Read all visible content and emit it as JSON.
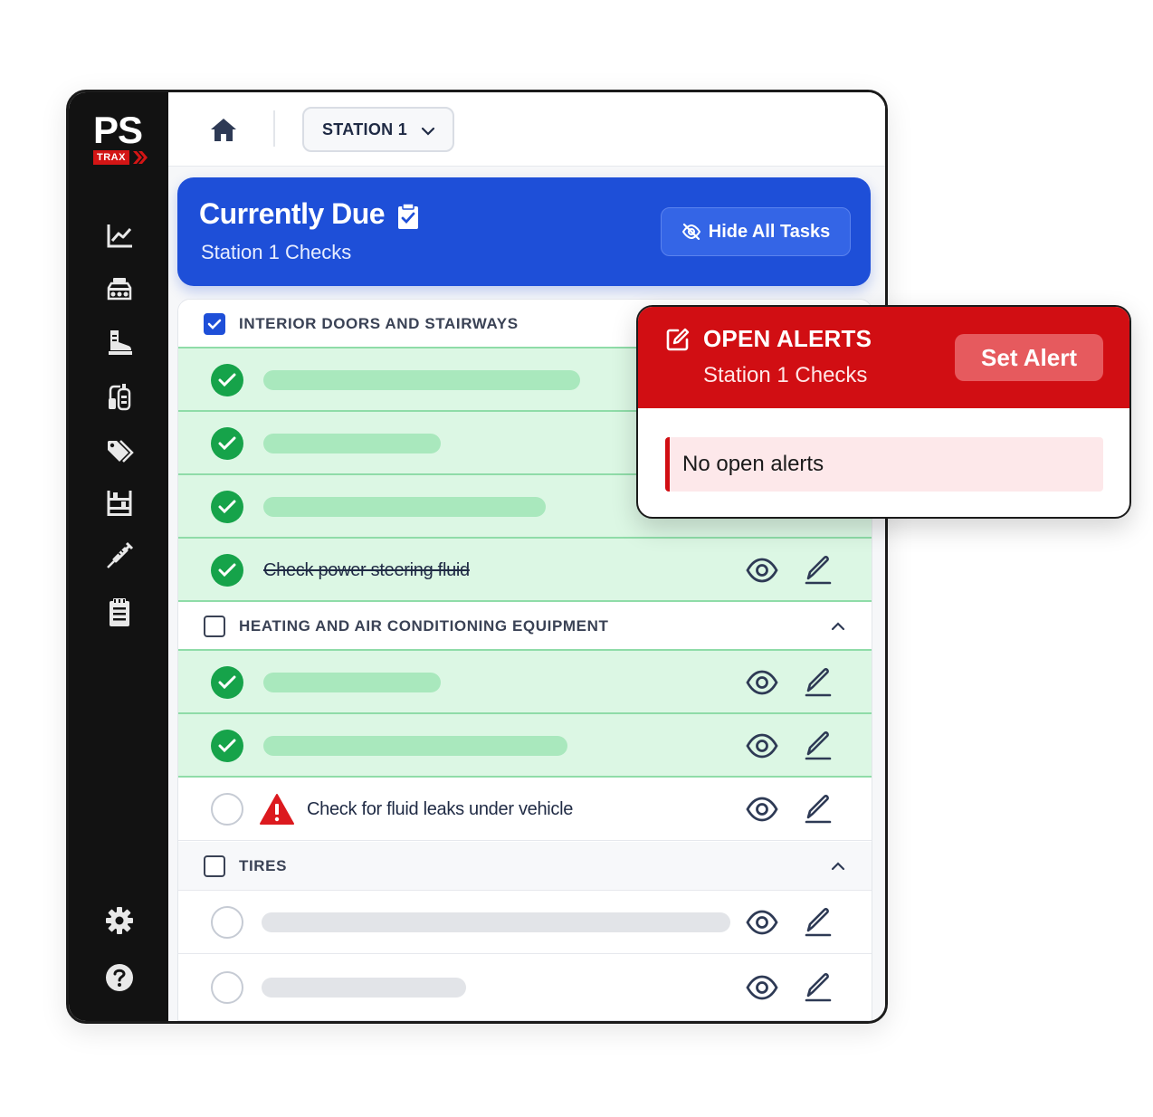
{
  "app": {
    "logo_text": "PS",
    "logo_sub": "TRAX"
  },
  "sidebar": {
    "items": [
      {
        "icon": "chart-line-icon"
      },
      {
        "icon": "vehicle-icon"
      },
      {
        "icon": "boot-icon"
      },
      {
        "icon": "oxygen-tank-icon"
      },
      {
        "icon": "tags-icon"
      },
      {
        "icon": "rack-icon"
      },
      {
        "icon": "syringe-icon"
      },
      {
        "icon": "clipboard-list-icon"
      }
    ],
    "bottom": [
      {
        "icon": "gear-icon"
      },
      {
        "icon": "help-icon"
      }
    ]
  },
  "topbar": {
    "station": "STATION 1"
  },
  "due": {
    "title": "Currently Due",
    "subtitle": "Station 1 Checks",
    "hide_button": "Hide All Tasks"
  },
  "sections": [
    {
      "title": "INTERIOR DOORS AND STAIRWAYS",
      "checked": true,
      "tasks": [
        {
          "status": "done",
          "text": ""
        },
        {
          "status": "done",
          "text": ""
        },
        {
          "status": "done",
          "text": ""
        },
        {
          "status": "done",
          "text": "Check power steering fluid"
        }
      ]
    },
    {
      "title": "HEATING AND AIR CONDITIONING EQUIPMENT",
      "checked": false,
      "tasks": [
        {
          "status": "done",
          "text": ""
        },
        {
          "status": "done",
          "text": ""
        },
        {
          "status": "open",
          "text": "Check for fluid leaks under vehicle",
          "warning": true
        }
      ]
    },
    {
      "title": "TIRES",
      "checked": false,
      "tasks": [
        {
          "status": "open",
          "text": ""
        },
        {
          "status": "open",
          "text": ""
        }
      ]
    }
  ],
  "alerts": {
    "title": "OPEN ALERTS",
    "subtitle": "Station 1 Checks",
    "button": "Set Alert",
    "empty_text": "No open alerts"
  },
  "colors": {
    "brand_blue": "#1e4fd8",
    "alert_red": "#d10e13",
    "done_green": "#16a34a"
  }
}
